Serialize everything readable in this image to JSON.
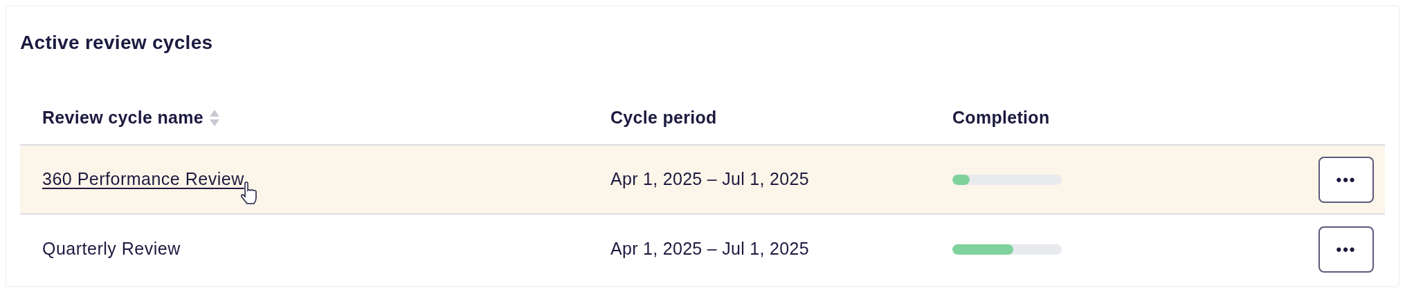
{
  "card": {
    "title": "Active review cycles"
  },
  "table": {
    "columns": [
      {
        "label": "Review cycle name",
        "sortable": true
      },
      {
        "label": "Cycle period",
        "sortable": false
      },
      {
        "label": "Completion",
        "sortable": false
      }
    ],
    "rows": [
      {
        "name": "360 Performance Review",
        "period": "Apr 1, 2025 – Jul 1, 2025",
        "level": 0.16,
        "hovered": true,
        "menu": "•••"
      },
      {
        "name": "Quarterly Review",
        "period": "Apr 1, 2025 – Jul 1, 2025",
        "level": 0.56,
        "hovered": false,
        "menu": "•••"
      }
    ]
  }
}
